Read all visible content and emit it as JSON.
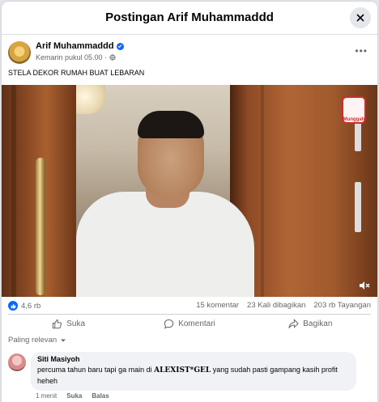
{
  "dialog": {
    "title": "Postingan Arif Muhammaddd"
  },
  "post": {
    "author": "Arif Muhammaddd",
    "meta_time": "Kemarin pukul 05.00 ·",
    "caption": "STELA DEKOR RUMAH BUAT LEBARAN",
    "video_overlay_logo": "Munggah"
  },
  "stats": {
    "reactions": "4,6 rb",
    "comments": "15 komentar",
    "shares": "23 Kali dibagikan",
    "views": "203 rb Tayangan"
  },
  "actions": {
    "like": "Suka",
    "comment": "Komentari",
    "share": "Bagikan"
  },
  "comments_sort": "Paling relevan",
  "comments": [
    {
      "author": "Siti Masiyoh",
      "text_before": "percuma tahun baru tapi ga main di ",
      "text_brand": "ALEXIST*GEL",
      "text_after": " yang sudah pasti gampang kasih profit heheh",
      "time": "1 menit",
      "like": "Suka",
      "reply": "Balas"
    }
  ],
  "colors": {
    "accent": "#0866ff",
    "text": "#050505",
    "muted": "#65676b"
  }
}
